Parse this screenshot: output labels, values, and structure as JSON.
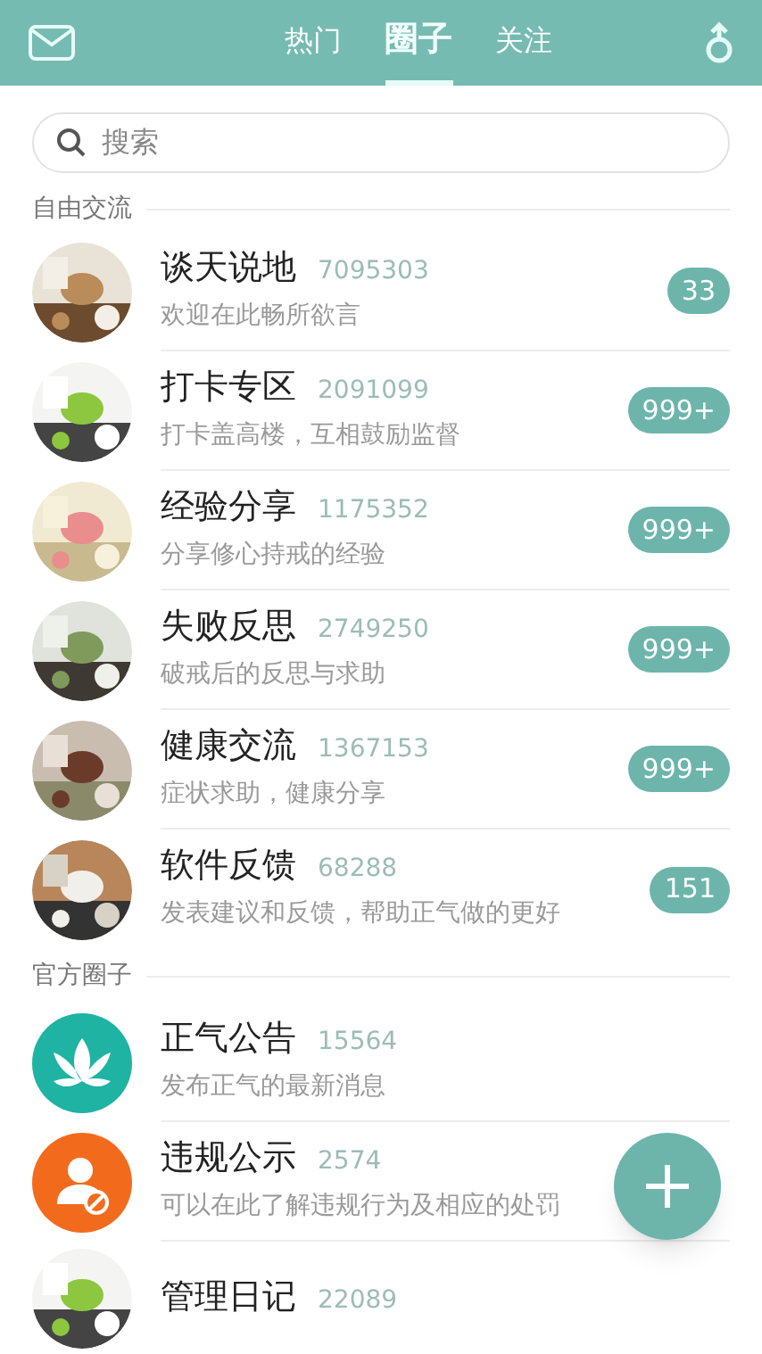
{
  "tabs": [
    {
      "label": "热门",
      "selected": false
    },
    {
      "label": "圈子",
      "selected": true
    },
    {
      "label": "关注",
      "selected": false
    }
  ],
  "search": {
    "placeholder": "搜索"
  },
  "sections": [
    {
      "title": "自由交流",
      "items": [
        {
          "kind": "picture",
          "name": "谈天说地",
          "count": "7095303",
          "description": "欢迎在此畅所欲言",
          "badge": "33"
        },
        {
          "kind": "picture",
          "name": "打卡专区",
          "count": "2091099",
          "description": "打卡盖高楼，互相鼓励监督",
          "badge": "999+"
        },
        {
          "kind": "picture",
          "name": "经验分享",
          "count": "1175352",
          "description": "分享修心持戒的经验",
          "badge": "999+"
        },
        {
          "kind": "picture",
          "name": "失败反思",
          "count": "2749250",
          "description": "破戒后的反思与求助",
          "badge": "999+"
        },
        {
          "kind": "picture",
          "name": "健康交流",
          "count": "1367153",
          "description": "症状求助，健康分享",
          "badge": "999+"
        },
        {
          "kind": "picture",
          "name": "软件反馈",
          "count": "68288",
          "description": "发表建议和反馈，帮助正气做的更好",
          "badge": "151"
        }
      ]
    },
    {
      "title": "官方圈子",
      "items": [
        {
          "kind": "lotus",
          "name": "正气公告",
          "count": "15564",
          "description": "发布正气的最新消息"
        },
        {
          "kind": "user-ban",
          "name": "违规公示",
          "count": "2574",
          "description": "可以在此了解违规行为及相应的处罚"
        },
        {
          "kind": "picture",
          "name": "管理日记",
          "count": "22089"
        }
      ]
    }
  ]
}
